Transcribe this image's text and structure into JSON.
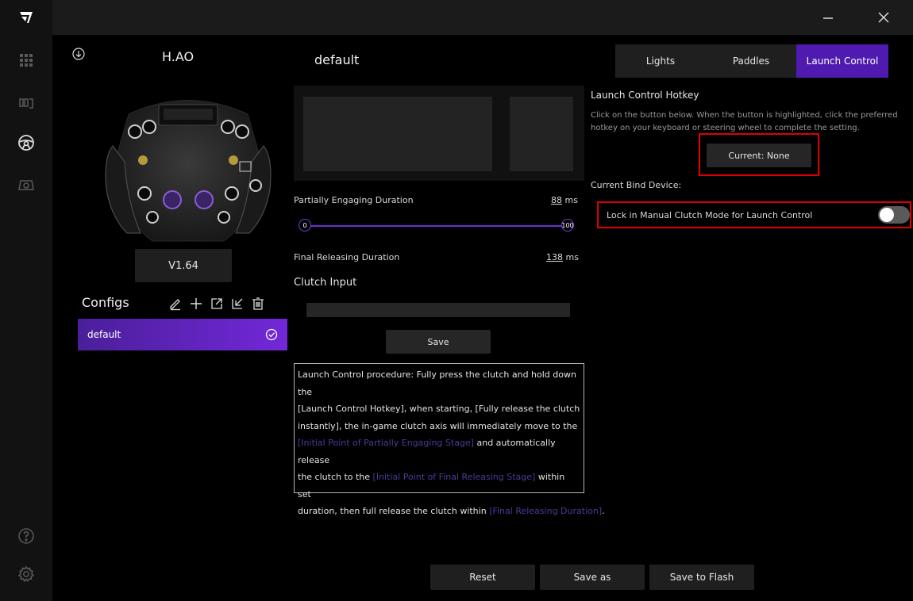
{
  "device": {
    "name": "H.AO",
    "firmware_version": "V1.64"
  },
  "configs": {
    "title": "Configs",
    "items": [
      {
        "label": "default",
        "selected": true
      }
    ]
  },
  "profile": {
    "name": "default"
  },
  "tabs": [
    {
      "label": "Lights",
      "active": false
    },
    {
      "label": "Paddles",
      "active": false
    },
    {
      "label": "Launch Control",
      "active": true
    }
  ],
  "launch": {
    "hotkey_title": "Launch Control Hotkey",
    "hotkey_help_1": "Click on the button below. When the button is highlighted, click the preferred",
    "hotkey_help_2": "hotkey on your keyboard or steering wheel to complete the setting.",
    "current_button": "Current: None",
    "bind_device_label": "Current Bind Device:",
    "lock_label": "Lock in Manual Clutch Mode for Launch Control",
    "lock_enabled": false
  },
  "partial": {
    "label": "Partially Engaging Duration",
    "value": "88",
    "unit": "ms",
    "min": "0",
    "max": "100"
  },
  "final": {
    "label": "Final Releasing Duration",
    "value": "138",
    "unit": "ms"
  },
  "clutch": {
    "title": "Clutch Input",
    "progress": 0,
    "save_label": "Save"
  },
  "info": {
    "l1": "Launch Control procedure: Fully press the clutch and hold down the",
    "l2": "[Launch Control Hotkey], when starting, [Fully release the clutch",
    "l3": "instantly], the in-game clutch axis will immediately move to the",
    "l4_hl": "[Initial Point of Partially Engaging Stage]",
    "l4_rest": " and automatically release",
    "l5_a": "the clutch to the ",
    "l5_hl": "[Initial Point of Final Releasing Stage]",
    "l5_rest": " within set",
    "l6_a": "duration, then full release the clutch within ",
    "l6_hl": "[Final Releasing Duration]",
    "l6_rest": "."
  },
  "footer": {
    "reset": "Reset",
    "save_as": "Save as",
    "save_flash": "Save to Flash"
  },
  "colors": {
    "accent": "#6d2fd8",
    "highlight_box": "#e00000"
  },
  "icons": {
    "rail": [
      "brand-logo-icon",
      "grid-icon",
      "pedals-icon",
      "steering-wheel-icon",
      "gamepad-icon",
      "help-icon",
      "settings-icon"
    ]
  }
}
